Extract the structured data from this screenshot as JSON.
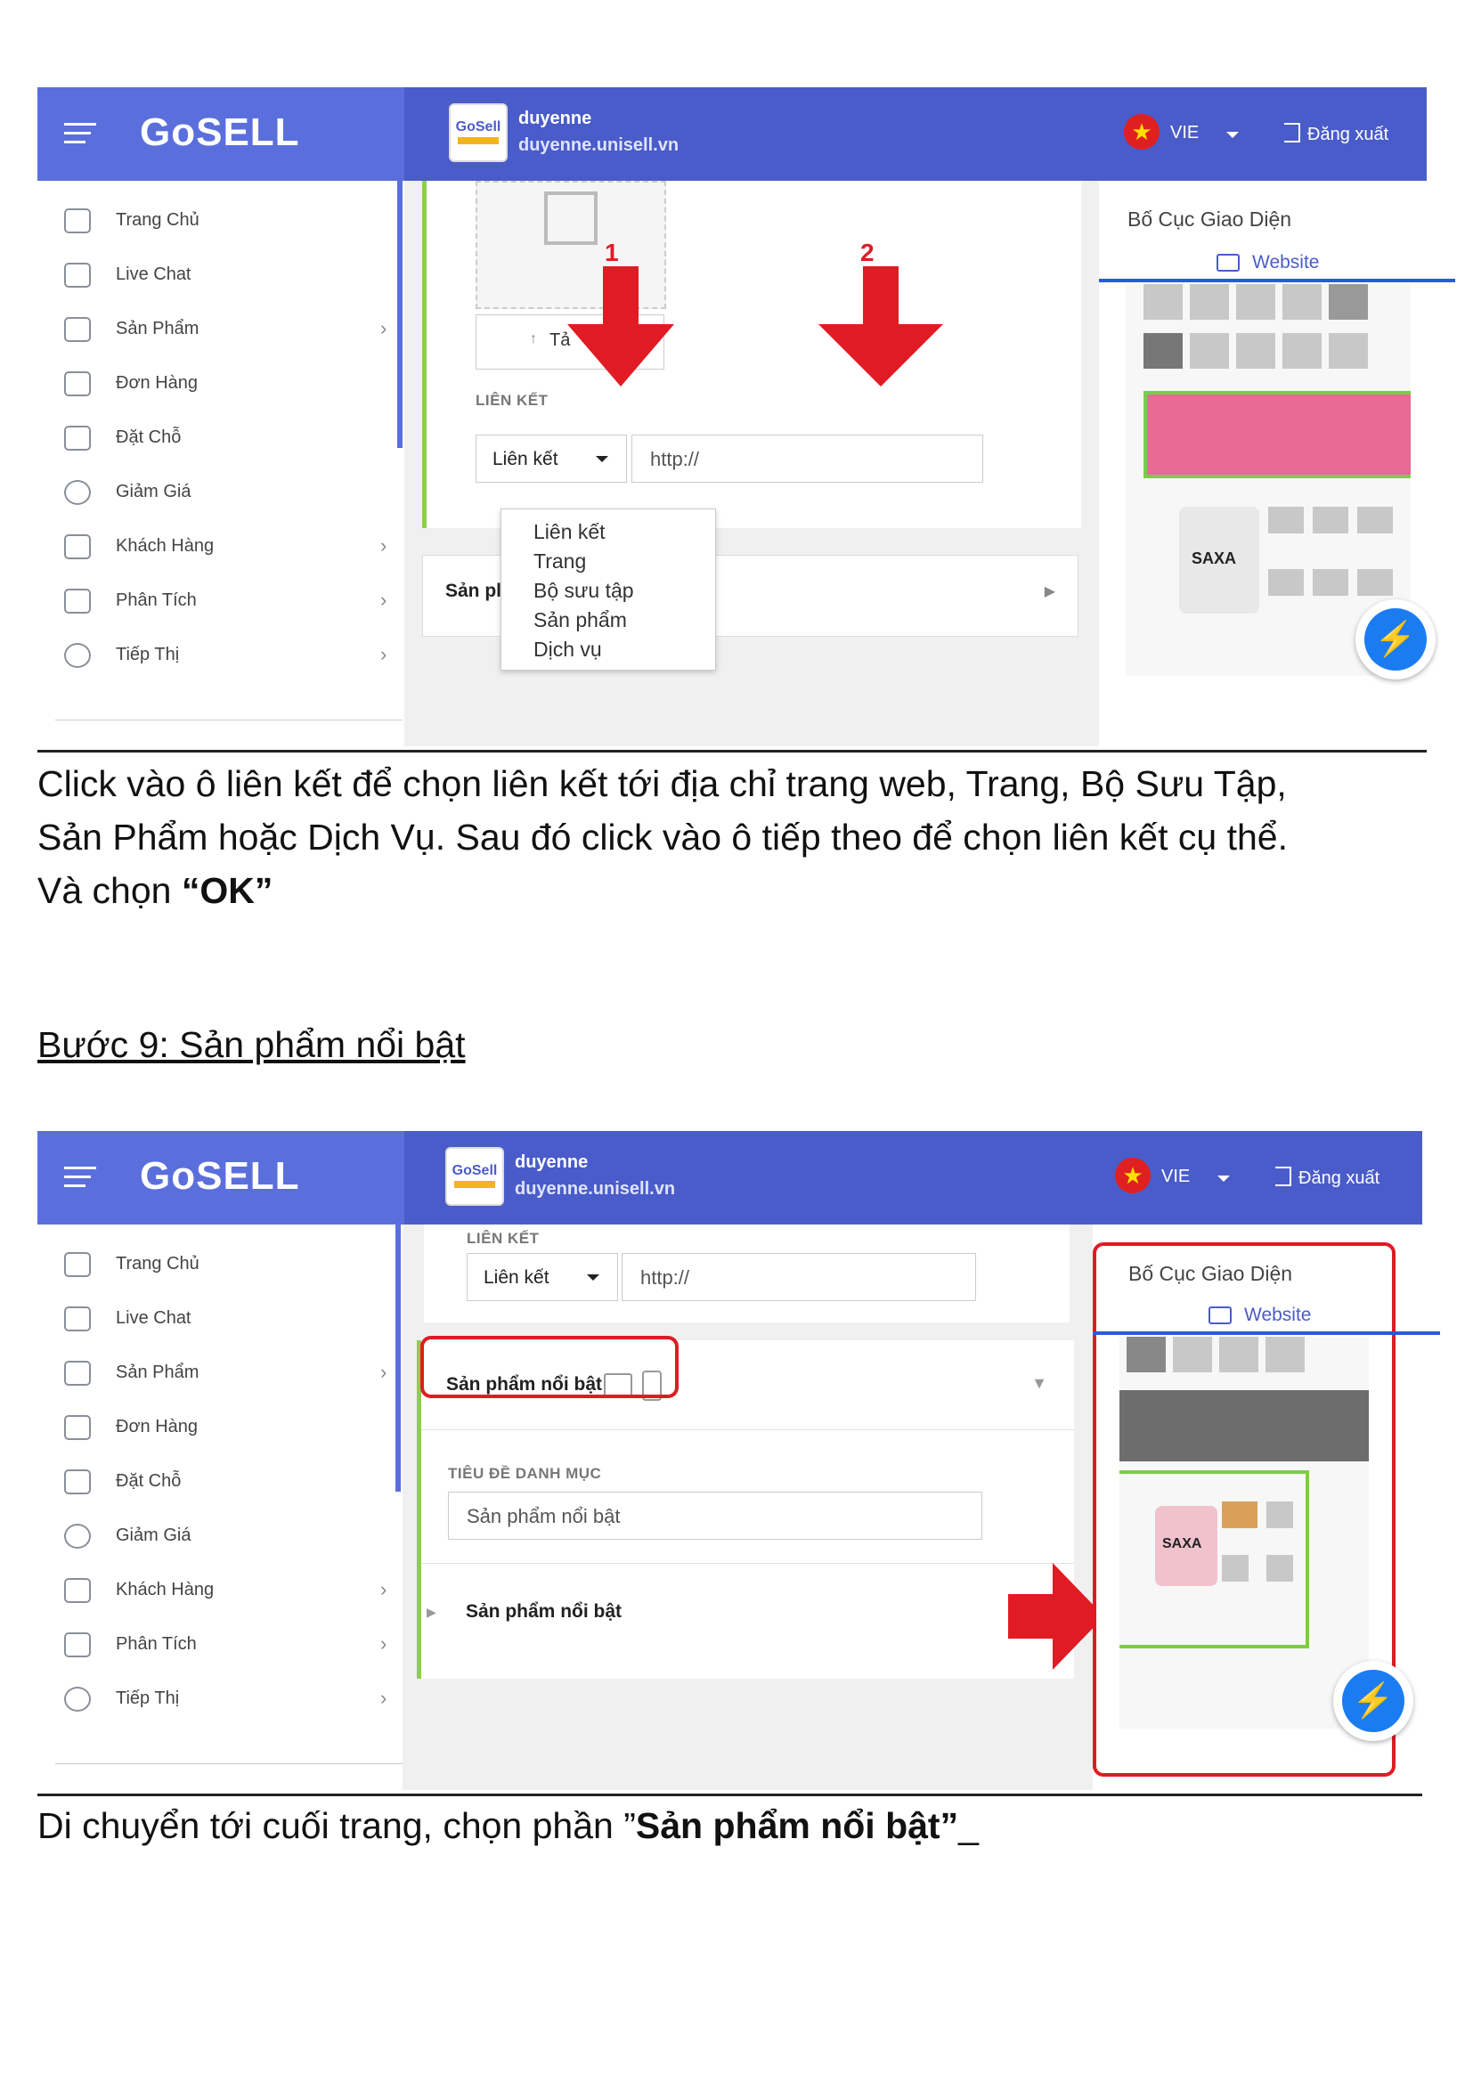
{
  "colors": {
    "topbar": "#4a5cc9",
    "brand": "#5b6fdc",
    "accent_red": "#e01b24",
    "accent_green": "#7ccc4a",
    "link_blue": "#4a5cc9"
  },
  "app": {
    "logo": "GoSELL",
    "shop_name": "duyenne",
    "shop_url": "duyenne.unisell.vn",
    "shop_icon_text": "GoSell",
    "language": "VIE",
    "flag_icon": "star-flag-icon",
    "logout_label": "Đăng xuất"
  },
  "sidebar": {
    "items": [
      {
        "label": "Trang Chủ",
        "icon": "home-icon",
        "has_chevron": false
      },
      {
        "label": "Live Chat",
        "icon": "chat-icon",
        "has_chevron": false
      },
      {
        "label": "Sản Phẩm",
        "icon": "tag-icon",
        "has_chevron": true
      },
      {
        "label": "Đơn Hàng",
        "icon": "order-icon",
        "has_chevron": false
      },
      {
        "label": "Đặt Chỗ",
        "icon": "calendar-icon",
        "has_chevron": false
      },
      {
        "label": "Giảm Giá",
        "icon": "discount-icon",
        "has_chevron": false
      },
      {
        "label": "Khách Hàng",
        "icon": "customers-icon",
        "has_chevron": true
      },
      {
        "label": "Phân Tích",
        "icon": "analytics-icon",
        "has_chevron": true
      },
      {
        "label": "Tiếp Thị",
        "icon": "marketing-icon",
        "has_chevron": true
      }
    ],
    "chevron": "›"
  },
  "screenshot1": {
    "upload_button": "Tả",
    "link_section_label": "LIÊN KẾT",
    "link_select_value": "Liên kết",
    "url_input_value": "http://",
    "dropdown_options": [
      "Liên kết",
      "Trang",
      "Bộ sưu tập",
      "Sản phẩm",
      "Dịch vụ"
    ],
    "collapsed_section": "Sản pl",
    "annotation_1": "1",
    "annotation_2": "2",
    "right_panel_title": "Bố Cục Giao Diện",
    "right_panel_tab": "Website",
    "product_brand": "SAXA"
  },
  "caption1": {
    "line1": "Click vào ô liên kết để chọn liên kết tới địa chỉ trang web, Trang, Bộ Sưu Tập,",
    "line2": "Sản Phẩm hoặc Dịch Vụ. Sau đó click vào ô tiếp theo để chọn liên kết cụ thể.",
    "line3_prefix": "Và chọn ",
    "line3_bold": "“OK”"
  },
  "heading_step9": "Bước 9: Sản phẩm nổi bật",
  "screenshot2": {
    "link_section_label": "LIÊN KẾT",
    "link_select_value": "Liên kết",
    "url_input_value": "http://",
    "section_title": "Sản phẩm nổi bật",
    "category_title_label": "TIÊU ĐỀ DANH MỤC",
    "category_title_value": "Sản phẩm nổi bật",
    "subsection_title": "Sản phẩm nổi bật",
    "right_panel_title": "Bố Cục Giao Diện",
    "right_panel_tab": "Website",
    "product_brand": "SAXA"
  },
  "caption2": {
    "prefix": "Di chuyển tới cuối trang, chọn phần ”",
    "bold": "Sản phẩm nổi bật”",
    "suffix": "_"
  }
}
